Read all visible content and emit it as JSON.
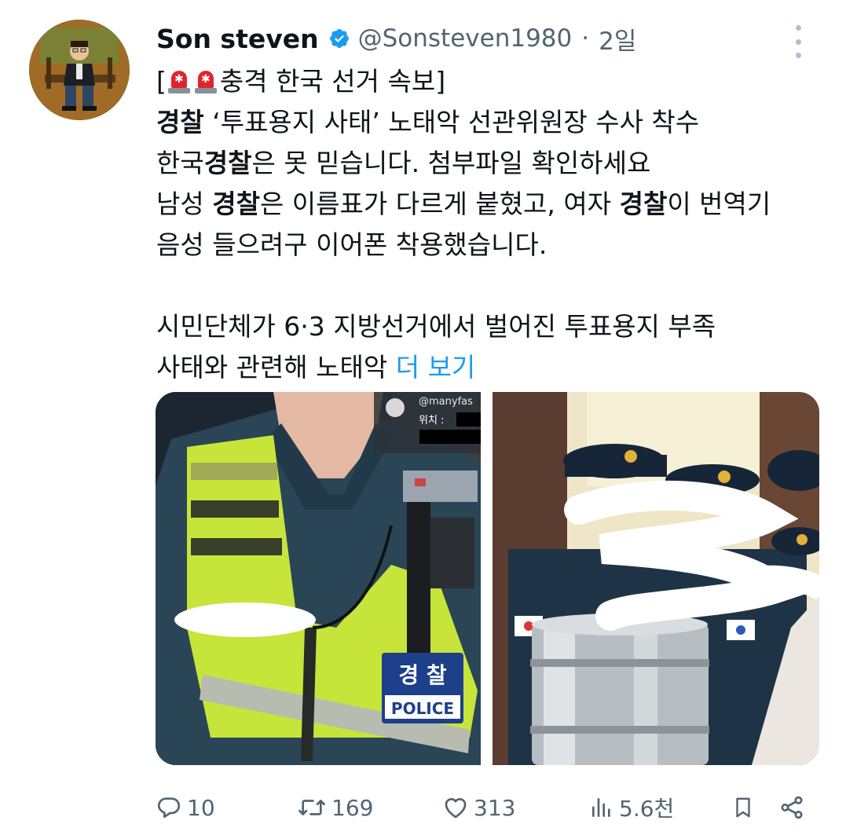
{
  "tweet": {
    "author": {
      "name": "Son steven",
      "handle": "@Sonsteven1980",
      "separator": "·",
      "time": "2일"
    },
    "text": {
      "l1_a": "[",
      "l1_b": "충격 한국 선거 속보]",
      "l2_b1": "경찰",
      "l2_t": " ‘투표용지 사태’ 노태악 선관위원장 수사 착수",
      "l3_a": "한국",
      "l3_b": "경찰",
      "l3_c": "은 못 믿습니다. 첨부파일 확인하세요",
      "l4_a": "남성 ",
      "l4_b": "경찰",
      "l4_c": "은 이름표가 다르게 붙혔고, 여자 ",
      "l4_d": "경찰",
      "l4_e": "이 번역기",
      "l5": "음성 들으려구 이어폰 착용했습니다.",
      "l6": "시민단체가 6·3 지방선거에서 벌어진 투표용지 부족",
      "l7_a": "사태와 관련해 노태악 ",
      "l7_more": "더 보기"
    },
    "media": {
      "left": {
        "watermark": "@manyfas",
        "location_label": "위치 :",
        "badge_korean": "경 찰",
        "badge_english": "POLICE"
      }
    },
    "metrics": {
      "replies": "10",
      "retweets": "169",
      "likes": "313",
      "views": "5.6천"
    }
  },
  "colors": {
    "text": "#0f1419",
    "muted": "#536471",
    "link": "#1d9bf0",
    "verified": "#1d9bf0"
  },
  "icons": [
    "reply-icon",
    "retweet-icon",
    "like-icon",
    "views-icon",
    "bookmark-icon",
    "share-icon",
    "verified-badge-icon",
    "more-icon",
    "siren-emoji"
  ]
}
